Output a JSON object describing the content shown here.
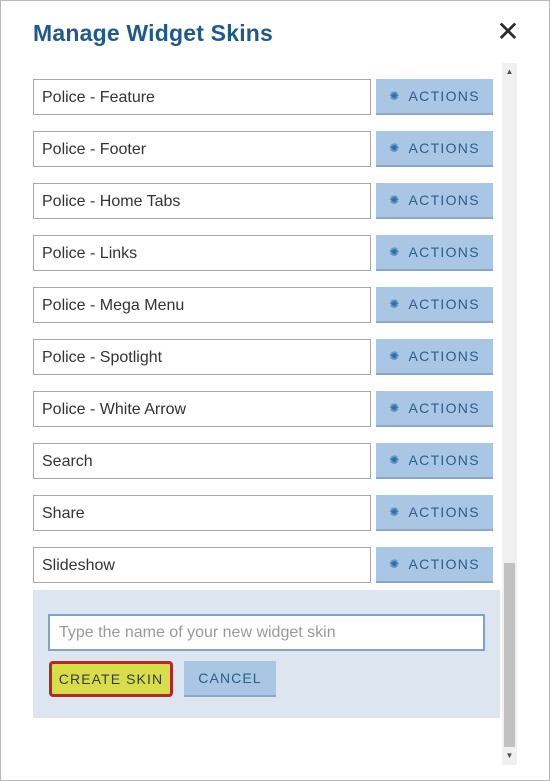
{
  "dialog": {
    "title": "Manage Widget Skins",
    "close_glyph": "✕"
  },
  "skins": [
    {
      "name": "Police - Feature",
      "action_label": "ACTIONS"
    },
    {
      "name": "Police - Footer",
      "action_label": "ACTIONS"
    },
    {
      "name": "Police - Home Tabs",
      "action_label": "ACTIONS"
    },
    {
      "name": "Police - Links",
      "action_label": "ACTIONS"
    },
    {
      "name": "Police - Mega Menu",
      "action_label": "ACTIONS"
    },
    {
      "name": "Police - Spotlight",
      "action_label": "ACTIONS"
    },
    {
      "name": "Police - White Arrow",
      "action_label": "ACTIONS"
    },
    {
      "name": "Search",
      "action_label": "ACTIONS"
    },
    {
      "name": "Share",
      "action_label": "ACTIONS"
    },
    {
      "name": "Slideshow",
      "action_label": "ACTIONS"
    }
  ],
  "create_panel": {
    "input_value": "",
    "input_placeholder": "Type the name of your new widget skin",
    "create_label": "CREATE SKIN",
    "cancel_label": "CANCEL"
  },
  "icons": {
    "row_action": "gear-icon",
    "close": "close-icon",
    "scroll_up": "scroll-up-arrow-icon",
    "scroll_down": "scroll-down-arrow-icon"
  },
  "colors": {
    "title": "#1f5a8a",
    "action_button_bg": "#a9c7e5",
    "action_button_text": "#2e5c86",
    "create_button_bg": "#d8dd4a",
    "create_button_border": "#b02a2a",
    "panel_bg": "#dce5f0"
  }
}
